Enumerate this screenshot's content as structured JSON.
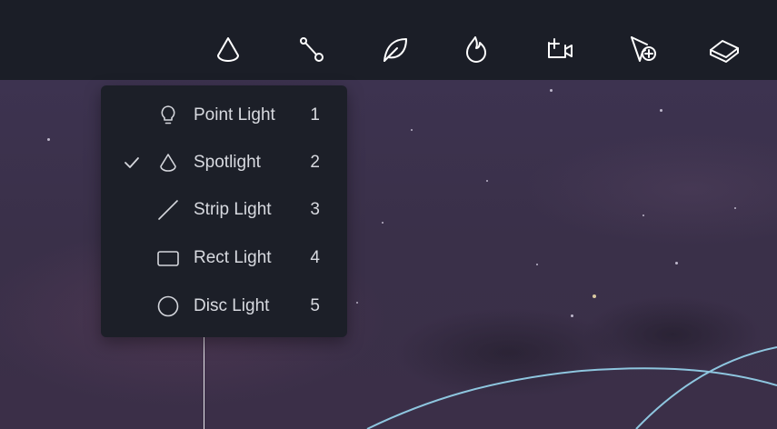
{
  "toolbar": {
    "tools": [
      {
        "icon": "spotlight-drop-icon"
      },
      {
        "icon": "path-node-icon"
      },
      {
        "icon": "leaf-icon"
      },
      {
        "icon": "flame-icon"
      },
      {
        "icon": "add-camera-icon"
      },
      {
        "icon": "cursor-add-icon"
      },
      {
        "icon": "layers-plane-icon"
      }
    ]
  },
  "light_menu": {
    "items": [
      {
        "label": "Point Light",
        "shortcut": "1",
        "icon": "bulb-icon",
        "checked": false
      },
      {
        "label": "Spotlight",
        "shortcut": "2",
        "icon": "spotlight-drop-icon",
        "checked": true
      },
      {
        "label": "Strip Light",
        "shortcut": "3",
        "icon": "line-icon",
        "checked": false
      },
      {
        "label": "Rect Light",
        "shortcut": "4",
        "icon": "rectangle-icon",
        "checked": false
      },
      {
        "label": "Disc Light",
        "shortcut": "5",
        "icon": "circle-icon",
        "checked": false
      }
    ]
  },
  "colors": {
    "toolbar_bg": "#1b1e27",
    "menu_bg": "#1c1f28",
    "viewport_bg": "#3a3049",
    "curve": "#8ec6df"
  }
}
